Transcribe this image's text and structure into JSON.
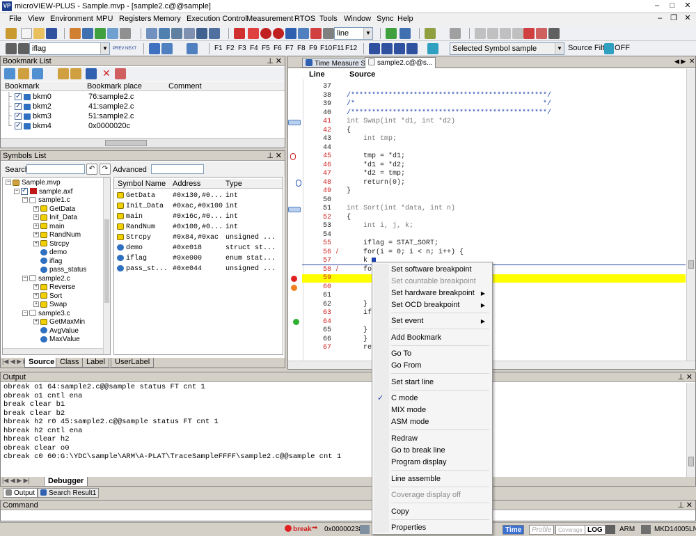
{
  "window": {
    "title": "microVIEW-PLUS - Sample.mvp - [sample2.c@@sample]"
  },
  "menu": [
    "File",
    "View",
    "Environment",
    "MPU",
    "Registers",
    "Memory",
    "Execution Control",
    "Measurement",
    "RTOS",
    "Tools",
    "Window",
    "Sync",
    "Help"
  ],
  "toolbar": {
    "display_combo": "line",
    "symbol_combo": "iflag",
    "fkeys": [
      "F1",
      "F2",
      "F3",
      "F4",
      "F5",
      "F6",
      "F7",
      "F8",
      "F9",
      "F10",
      "F11",
      "F12"
    ],
    "selected_symbol_label": "Selected Symbol",
    "selected_symbol_value": "sample",
    "source_filter_label": "Source Filter",
    "source_filter_value": "OFF",
    "prev_label": "PREV",
    "next_label": "NEXT"
  },
  "bookmark": {
    "title": "Bookmark List",
    "headers": [
      "Bookmark",
      "Bookmark place",
      "Comment"
    ],
    "rows": [
      {
        "name": "bkm0",
        "place": "76:sample2.c"
      },
      {
        "name": "bkm2",
        "place": "41:sample2.c"
      },
      {
        "name": "bkm3",
        "place": "51:sample2.c"
      },
      {
        "name": "bkm4",
        "place": "0x0000020c"
      }
    ]
  },
  "symbols": {
    "title": "Symbols List",
    "search_label": "Search",
    "advanced_label": "Advanced",
    "tree": {
      "root": "Sample.mvp",
      "axf": "sample.axf",
      "file1": "sample1.c",
      "file1_items": [
        "GetData",
        "Init_Data",
        "main",
        "RandNum",
        "Strcpy",
        "demo",
        "iflag",
        "pass_status"
      ],
      "file2": "sample2.c",
      "file2_items": [
        "Reverse",
        "Sort",
        "Swap"
      ],
      "file3": "sample3.c",
      "file3_items": [
        "GetMaxMin",
        "AvgValue",
        "MaxValue"
      ]
    },
    "headers": [
      "Symbol Name",
      "Address",
      "Type"
    ],
    "rows": [
      {
        "name": "GetData",
        "addr": "#0x130,#0...",
        "type": "int"
      },
      {
        "name": "Init_Data",
        "addr": "#0xac,#0x100",
        "type": "int"
      },
      {
        "name": "main",
        "addr": "#0x16c,#0...",
        "type": "int"
      },
      {
        "name": "RandNum",
        "addr": "#0x100,#0...",
        "type": "int"
      },
      {
        "name": "Strcpy",
        "addr": "#0x84,#0xac",
        "type": "unsigned ..."
      },
      {
        "name": "demo",
        "addr": "#0xe018",
        "type": "struct st..."
      },
      {
        "name": "iflag",
        "addr": "#0xe000",
        "type": "enum stat..."
      },
      {
        "name": "pass_st...",
        "addr": "#0xe044",
        "type": "unsigned ..."
      }
    ],
    "tabs": [
      "Source",
      "Class",
      "Label",
      "UserLabel"
    ]
  },
  "source": {
    "tabs": [
      "Time Measure S.",
      "sample2.c@@s..."
    ],
    "headers": [
      "Line",
      "Source"
    ],
    "lines": [
      {
        "n": "37",
        "code": ""
      },
      {
        "n": "38",
        "code": "/***********************************************/"
      },
      {
        "n": "39",
        "code": "/*                                             */"
      },
      {
        "n": "40",
        "code": "/***********************************************/"
      },
      {
        "n": "41",
        "code": "int Swap(int *d1, int *d2)"
      },
      {
        "n": "42",
        "code": "{"
      },
      {
        "n": "43",
        "code": "    int tmp;"
      },
      {
        "n": "44",
        "code": ""
      },
      {
        "n": "45",
        "code": "    tmp = *d1;"
      },
      {
        "n": "46",
        "code": "    *d1 = *d2;"
      },
      {
        "n": "47",
        "code": "    *d2 = tmp;"
      },
      {
        "n": "48",
        "code": "    return(0);"
      },
      {
        "n": "49",
        "code": "}"
      },
      {
        "n": "50",
        "code": ""
      },
      {
        "n": "51",
        "code": "int Sort(int *data, int n)"
      },
      {
        "n": "52",
        "code": "{"
      },
      {
        "n": "53",
        "code": "    int i, j, k;"
      },
      {
        "n": "54",
        "code": ""
      },
      {
        "n": "55",
        "code": "    iflag = STAT_SORT;"
      },
      {
        "n": "56",
        "code": "    for(i = 0; i < n; i++) {"
      },
      {
        "n": "57",
        "code": "    k = "
      },
      {
        "n": "58",
        "code": "    fo"
      },
      {
        "n": "59",
        "code": ""
      },
      {
        "n": "60",
        "code": ""
      },
      {
        "n": "61",
        "code": ""
      },
      {
        "n": "62",
        "code": "    }"
      },
      {
        "n": "63",
        "code": "    if"
      },
      {
        "n": "64",
        "code": ""
      },
      {
        "n": "65",
        "code": "    }"
      },
      {
        "n": "66",
        "code": "    }"
      },
      {
        "n": "67",
        "code": "    re"
      }
    ]
  },
  "context_menu": {
    "items": [
      {
        "label": "Set software breakpoint",
        "dis": false,
        "sub": false
      },
      {
        "label": "Set countable breakpoint",
        "dis": true,
        "sub": false
      },
      {
        "label": "Set hardware breakpoint",
        "dis": false,
        "sub": true
      },
      {
        "label": "Set OCD breakpoint",
        "dis": false,
        "sub": true
      },
      {
        "label": "Set event",
        "dis": false,
        "sub": true
      },
      {
        "label": "Add Bookmark",
        "dis": false,
        "sub": false
      },
      {
        "label": "Go To",
        "dis": false,
        "sub": false
      },
      {
        "label": "Go From",
        "dis": false,
        "sub": false
      },
      {
        "label": "Set start line",
        "dis": false,
        "sub": false
      },
      {
        "label": "C mode",
        "dis": false,
        "sub": false,
        "checked": true
      },
      {
        "label": "MIX mode",
        "dis": false,
        "sub": false
      },
      {
        "label": "ASM mode",
        "dis": false,
        "sub": false
      },
      {
        "label": "Redraw",
        "dis": false,
        "sub": false
      },
      {
        "label": "Go to break line",
        "dis": false,
        "sub": false
      },
      {
        "label": "Program display",
        "dis": false,
        "sub": false
      },
      {
        "label": "Line assemble",
        "dis": false,
        "sub": false
      },
      {
        "label": "Coverage display off",
        "dis": true,
        "sub": false
      },
      {
        "label": "Copy",
        "dis": false,
        "sub": false
      },
      {
        "label": "Properties",
        "dis": false,
        "sub": false
      }
    ]
  },
  "output": {
    "title": "Output",
    "lines": [
      "obreak o1 64:sample2.c@@sample status FT cnt 1",
      "obreak o1 cntl ena",
      "break clear b1",
      "break clear b2",
      "hbreak h2 r0 45:sample2.c@@sample status FT cnt 1",
      "hbreak h2 cntl ena",
      "hbreak clear h2",
      "obreak clear o0",
      "cbreak c0 60:G:\\YDC\\sample\\ARM\\A-PLAT\\TraceSampleFFFF\\sample2.c@@sample cnt 1"
    ],
    "tab": "Debugger",
    "bottom_tabs": [
      "Output",
      "Search Result1"
    ]
  },
  "command": {
    "title": "Command"
  },
  "status": {
    "break": "break",
    "address": "0x00000238",
    "time": "Time",
    "profile": "Profile",
    "coverage": "Coverage",
    "log": "LOG",
    "arch": "ARM",
    "device": "MKD14005LN"
  }
}
